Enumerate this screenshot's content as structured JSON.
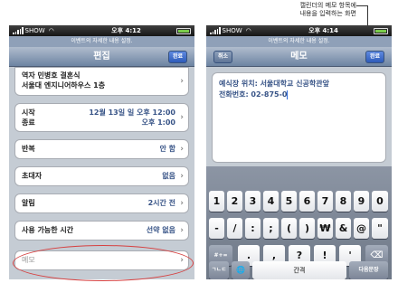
{
  "callout": {
    "line1": "캘린더의 메모 항목에",
    "line2": "내용을 입력하는 화면"
  },
  "left": {
    "status": {
      "carrier": "SHOW",
      "time": "오후 4:12"
    },
    "prompt": "이벤트의 자세한 내용 설정.",
    "nav": {
      "title": "편집",
      "done": "완료"
    },
    "location": {
      "line1": "역자 민병호 결혼식",
      "line2": "서울대 엔지니어하우스 1층"
    },
    "start_label": "시작",
    "end_label": "종료",
    "start_value": "12월 13일 일 오후 12:00",
    "end_value": "오후 1:00",
    "rows": [
      {
        "label": "반복",
        "value": "안 함"
      },
      {
        "label": "초대자",
        "value": "없음"
      },
      {
        "label": "알림",
        "value": "2시간 전"
      },
      {
        "label": "사용 가능한 시간",
        "value": "선약 없음"
      }
    ],
    "memo_label": "메모"
  },
  "right": {
    "status": {
      "carrier": "SHOW",
      "time": "오후 4:14"
    },
    "prompt": "이벤트의 자세한 내용 설정.",
    "nav": {
      "title": "메모",
      "cancel": "취소",
      "done": "완료"
    },
    "memo_line1": "예식장 위치: 서울대학교 신공학관앞",
    "memo_line2": "전화번호: 02-875-0",
    "keys_row1": [
      "1",
      "2",
      "3",
      "4",
      "5",
      "6",
      "7",
      "8",
      "9",
      "0"
    ],
    "keys_row2": [
      "-",
      "/",
      ":",
      ";",
      "(",
      ")",
      "₩",
      "&",
      "@",
      "\""
    ],
    "keys_row3": [
      ".",
      ",",
      "?",
      "!",
      "'"
    ],
    "key_symbols": "#+=",
    "key_delete": "⌫",
    "key_lang": "ㄱㄴㄷ",
    "key_globe": "🌐",
    "key_space": "간격",
    "key_next": "다음문장"
  }
}
